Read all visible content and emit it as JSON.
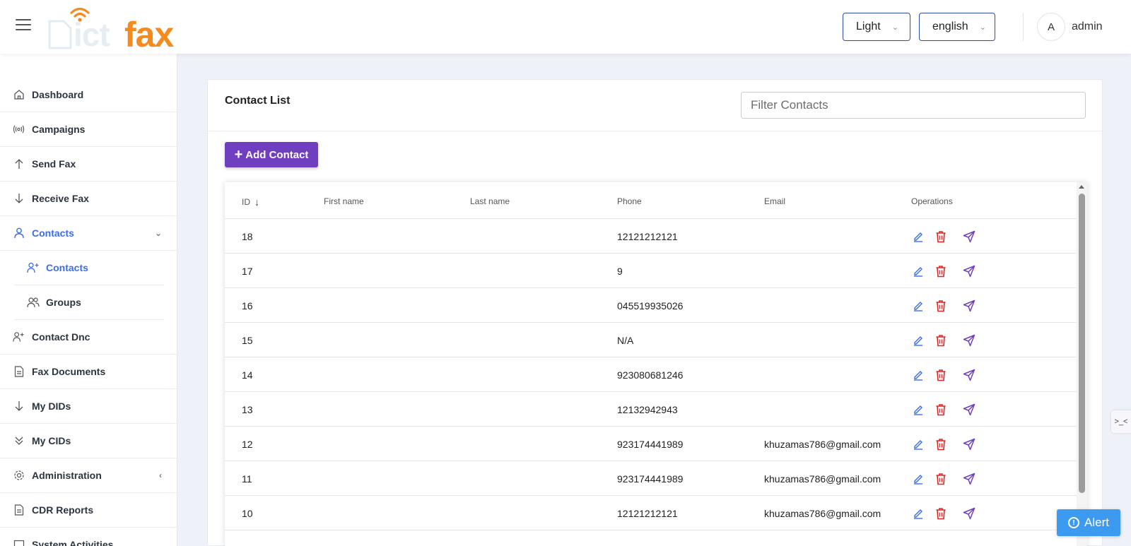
{
  "header": {
    "logo_text_faint": "ict",
    "logo_text": "fax",
    "theme_select": "Light",
    "language_select": "english",
    "avatar_initial": "A",
    "user_name": "admin"
  },
  "sidebar": {
    "items": [
      {
        "label": "Dashboard",
        "icon": "home-icon"
      },
      {
        "label": "Campaigns",
        "icon": "broadcast-icon"
      },
      {
        "label": "Send Fax",
        "icon": "arrow-up-icon"
      },
      {
        "label": "Receive Fax",
        "icon": "arrow-down-icon"
      },
      {
        "label": "Contacts",
        "icon": "user-icon"
      },
      {
        "label": "Contact Dnc",
        "icon": "user-plus-icon"
      },
      {
        "label": "Fax Documents",
        "icon": "document-icon"
      },
      {
        "label": "My DIDs",
        "icon": "arrow-down-icon"
      },
      {
        "label": "My CIDs",
        "icon": "double-chevron-down-icon"
      },
      {
        "label": "Administration",
        "icon": "gear-icon"
      },
      {
        "label": "CDR Reports",
        "icon": "document-icon"
      },
      {
        "label": "System Activities",
        "icon": "monitor-icon"
      }
    ],
    "sub_items": [
      {
        "label": "Contacts",
        "icon": "user-plus-icon"
      },
      {
        "label": "Groups",
        "icon": "users-icon"
      }
    ],
    "active_color": "#3b6ee8"
  },
  "main": {
    "title": "Contact List",
    "filter_placeholder": "Filter Contacts",
    "add_button": "Add Contact",
    "add_button_color": "#6f3fc0",
    "columns": [
      "ID",
      "First name",
      "Last name",
      "Phone",
      "Email",
      "Operations"
    ],
    "rows": [
      {
        "id": "18",
        "first": "",
        "last": "",
        "phone": "12121212121",
        "email": ""
      },
      {
        "id": "17",
        "first": "",
        "last": "",
        "phone": "9",
        "email": ""
      },
      {
        "id": "16",
        "first": "",
        "last": "",
        "phone": "045519935026",
        "email": ""
      },
      {
        "id": "15",
        "first": "",
        "last": "",
        "phone": "N/A",
        "email": ""
      },
      {
        "id": "14",
        "first": "",
        "last": "",
        "phone": "923080681246",
        "email": ""
      },
      {
        "id": "13",
        "first": "",
        "last": "",
        "phone": "12132942943",
        "email": ""
      },
      {
        "id": "12",
        "first": "",
        "last": "",
        "phone": "923174441989",
        "email": "khuzamas786@gmail.com"
      },
      {
        "id": "11",
        "first": "",
        "last": "",
        "phone": "923174441989",
        "email": "khuzamas786@gmail.com"
      },
      {
        "id": "10",
        "first": "",
        "last": "",
        "phone": "12121212121",
        "email": "khuzamas786@gmail.com"
      }
    ]
  },
  "side_toggle": ">_<",
  "alert_button": "Alert",
  "colors": {
    "edit": "#3b6ee8",
    "delete": "#e02424",
    "send": "#6f3fc0",
    "alert": "#3c9bf0",
    "logo": "#f58a1f"
  }
}
